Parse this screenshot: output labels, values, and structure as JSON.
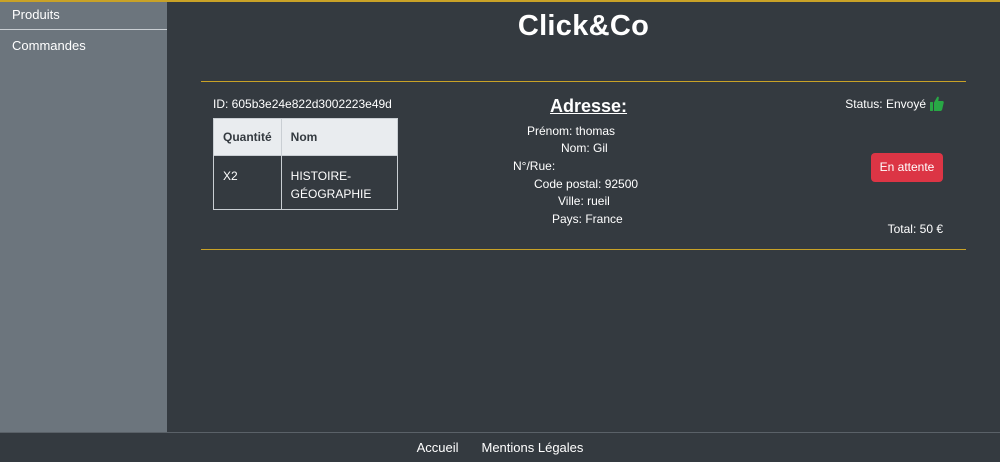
{
  "sidebar": {
    "items": [
      {
        "label": "Produits"
      },
      {
        "label": "Commandes"
      }
    ]
  },
  "header": {
    "brand": "Click&Co"
  },
  "order": {
    "id_text": "ID: 605b3e24e822d3002223e49d",
    "table": {
      "headers": [
        "Quantité",
        "Nom"
      ],
      "rows": [
        {
          "qty": "X2",
          "name": "HISTOIRE-GÉOGRAPHIE"
        }
      ]
    },
    "address": {
      "title": "Adresse:",
      "prenom": "Prénom: thomas",
      "nom": "Nom: Gil",
      "rue": "N°/Rue:",
      "code_postal": "Code postal: 92500",
      "ville": "Ville: rueil",
      "pays": "Pays: France"
    },
    "status_text": "Status: Envoyé",
    "status_icon": "thumbs-up-icon",
    "status_color": "#28a745",
    "action_label": "En attente",
    "action_color": "#dc3545",
    "total_text": "Total: 50 €"
  },
  "footer": {
    "links": [
      {
        "label": "Accueil"
      },
      {
        "label": "Mentions Légales"
      }
    ]
  },
  "colors": {
    "background": "#343a40",
    "sidebar": "#6c757d",
    "accent": "#c9a227"
  }
}
